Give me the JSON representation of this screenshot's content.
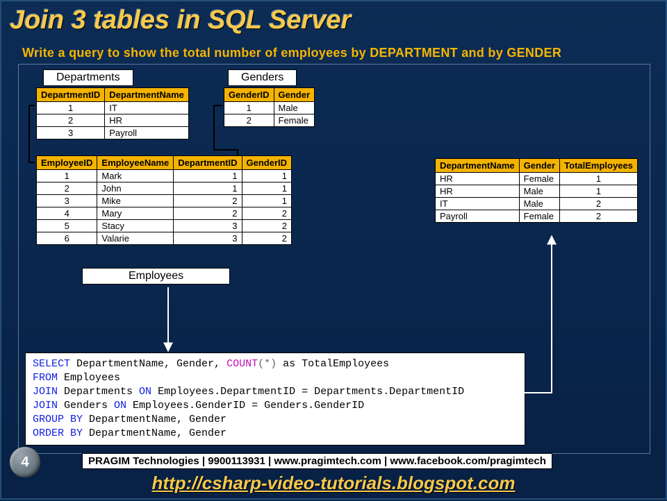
{
  "title": "Join 3 tables in SQL Server",
  "subtitle": "Write a query to show the total number of employees by DEPARTMENT and by GENDER",
  "labels": {
    "departments": "Departments",
    "genders": "Genders",
    "employees": "Employees"
  },
  "departments": {
    "headers": [
      "DepartmentID",
      "DepartmentName"
    ],
    "rows": [
      [
        "1",
        "IT"
      ],
      [
        "2",
        "HR"
      ],
      [
        "3",
        "Payroll"
      ]
    ]
  },
  "genders": {
    "headers": [
      "GenderID",
      "Gender"
    ],
    "rows": [
      [
        "1",
        "Male"
      ],
      [
        "2",
        "Female"
      ]
    ]
  },
  "employees": {
    "headers": [
      "EmployeeID",
      "EmployeeName",
      "DepartmentID",
      "GenderID"
    ],
    "rows": [
      [
        "1",
        "Mark",
        "1",
        "1"
      ],
      [
        "2",
        "John",
        "1",
        "1"
      ],
      [
        "3",
        "Mike",
        "2",
        "1"
      ],
      [
        "4",
        "Mary",
        "2",
        "2"
      ],
      [
        "5",
        "Stacy",
        "3",
        "2"
      ],
      [
        "6",
        "Valarie",
        "3",
        "2"
      ]
    ]
  },
  "result": {
    "headers": [
      "DepartmentName",
      "Gender",
      "TotalEmployees"
    ],
    "rows": [
      [
        "HR",
        "Female",
        "1"
      ],
      [
        "HR",
        "Male",
        "1"
      ],
      [
        "IT",
        "Male",
        "2"
      ],
      [
        "Payroll",
        "Female",
        "2"
      ]
    ]
  },
  "sql": {
    "k_select": "SELECT",
    "f_count": "COUNT",
    "op_star": "(*)",
    "txt_as": " as TotalEmployees",
    "sel_cols": " DepartmentName, Gender, ",
    "k_from": "FROM",
    "t_emp": " Employees",
    "k_join1": "JOIN",
    "j1": " Departments ",
    "k_on1": "ON",
    "on1": " Employees.DepartmentID = Departments.DepartmentID",
    "k_join2": "JOIN",
    "j2": " Genders ",
    "k_on2": "ON",
    "on2": " Employees.GenderID = Genders.GenderID",
    "k_group": "GROUP BY",
    "grp": " DepartmentName, Gender",
    "k_order": "ORDER BY",
    "ord": " DepartmentName, Gender"
  },
  "footer": {
    "credit": "PRAGIM Technologies | 9900113931 | www.pragimtech.com | www.facebook.com/pragimtech",
    "url": "http://csharp-video-tutorials.blogspot.com"
  },
  "page": "4"
}
